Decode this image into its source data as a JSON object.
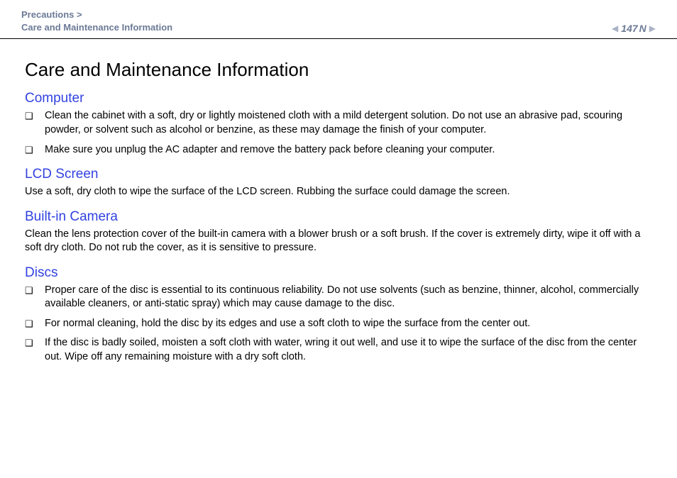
{
  "header": {
    "breadcrumb_line1": "Precautions >",
    "breadcrumb_line2": "Care and Maintenance Information",
    "page_number": "147",
    "n_suffix": "n",
    "n_prefix": "N"
  },
  "title": "Care and Maintenance Information",
  "sections": {
    "computer": {
      "heading": "Computer",
      "bullets": [
        "Clean the cabinet with a soft, dry or lightly moistened cloth with a mild detergent solution. Do not use an abrasive pad, scouring powder, or solvent such as alcohol or benzine, as these may damage the finish of your computer.",
        "Make sure you unplug the AC adapter and remove the battery pack before cleaning your computer."
      ]
    },
    "lcd": {
      "heading": "LCD Screen",
      "body": "Use a soft, dry cloth to wipe the surface of the LCD screen. Rubbing the surface could damage the screen."
    },
    "camera": {
      "heading": "Built-in Camera",
      "body": "Clean the lens protection cover of the built-in camera with a blower brush or a soft brush. If the cover is extremely dirty, wipe it off with a soft dry cloth. Do not rub the cover, as it is sensitive to pressure."
    },
    "discs": {
      "heading": "Discs",
      "bullets": [
        "Proper care of the disc is essential to its continuous reliability. Do not use solvents (such as benzine, thinner, alcohol, commercially available cleaners, or anti-static spray) which may cause damage to the disc.",
        "For normal cleaning, hold the disc by its edges and use a soft cloth to wipe the surface from the center out.",
        "If the disc is badly soiled, moisten a soft cloth with water, wring it out well, and use it to wipe the surface of the disc from the center out. Wipe off any remaining moisture with a dry soft cloth."
      ]
    }
  }
}
